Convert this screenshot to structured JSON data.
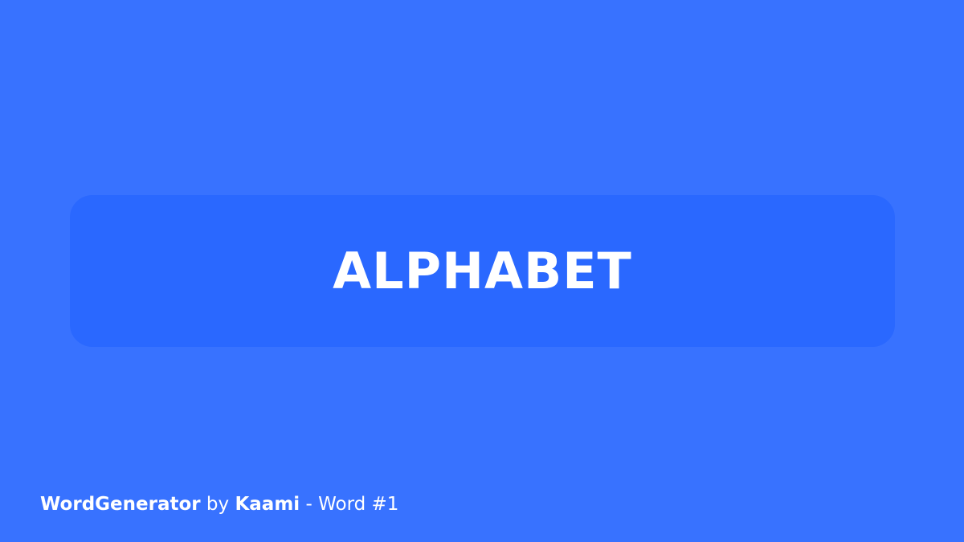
{
  "word": "ALPHABET",
  "footer": {
    "app_name": "WordGenerator",
    "by_text": " by ",
    "author": "Kaami",
    "word_label": " - Word #1"
  },
  "colors": {
    "background": "#3872ff",
    "card": "#2a68ff",
    "text": "#ffffff"
  }
}
